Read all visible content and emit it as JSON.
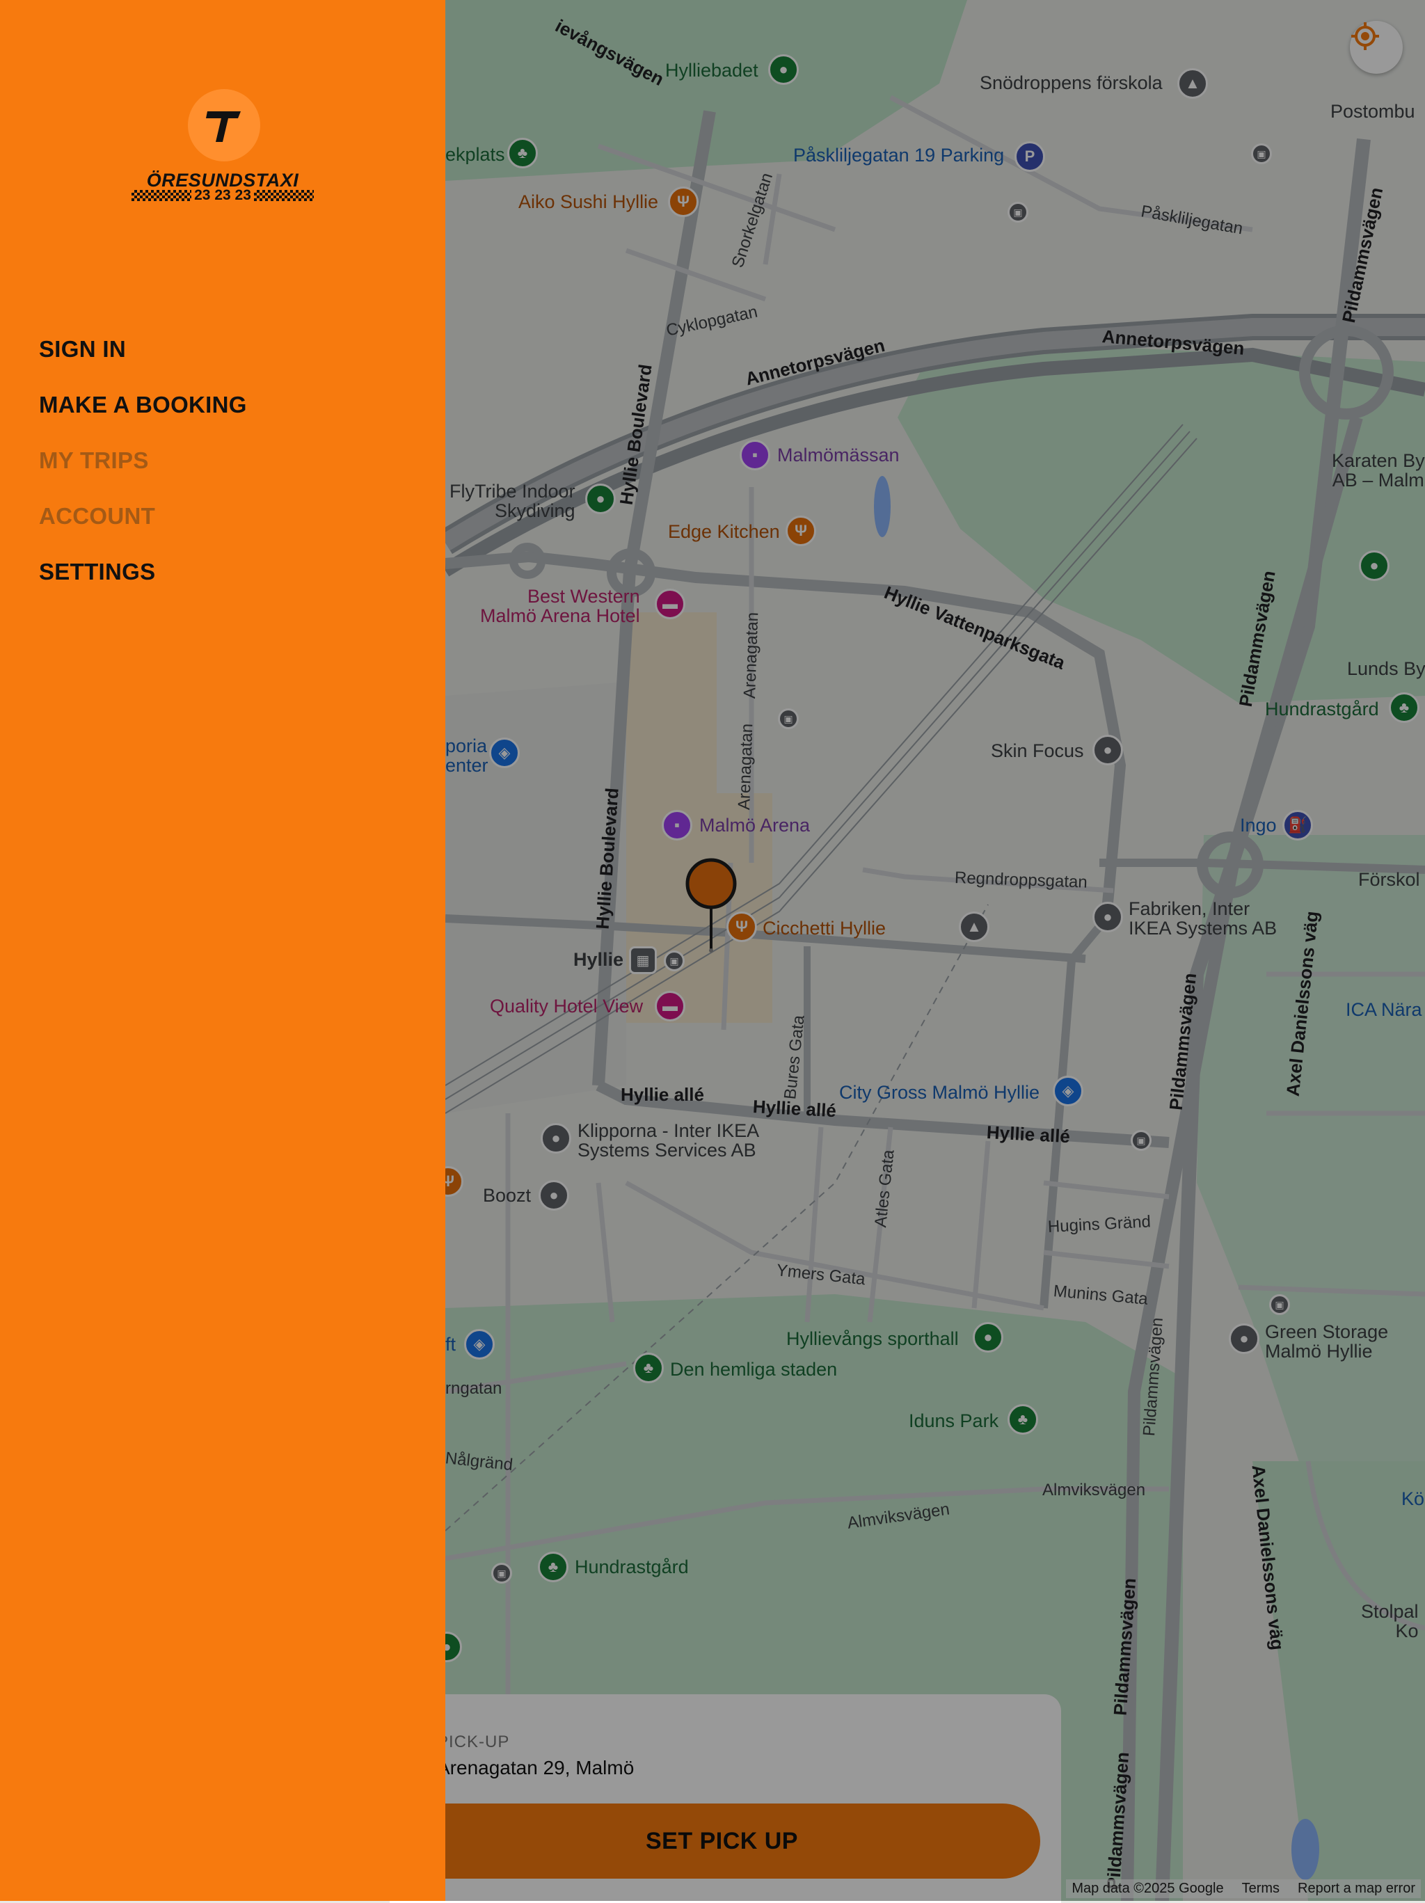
{
  "drawer": {
    "logo": {
      "name": "ÖRESUNDSTAXI",
      "phone": "23 23 23",
      "initial": "T"
    },
    "menu": [
      {
        "label": "SIGN IN",
        "enabled": true
      },
      {
        "label": "MAKE A BOOKING",
        "enabled": true
      },
      {
        "label": "MY TRIPS",
        "enabled": false
      },
      {
        "label": "ACCOUNT",
        "enabled": false
      },
      {
        "label": "SETTINGS",
        "enabled": true
      }
    ],
    "color": "#f77a0e"
  },
  "map": {
    "poi": {
      "hylliebadet": "Hylliebadet",
      "snodroppens": "Snödroppens förskola",
      "postombud": "Postombu",
      "ekplats": "ekplats",
      "paskliljegatan_parking": "Påskliljegatan 19 Parking",
      "aiko_sushi": "Aiko Sushi Hyllie",
      "malmomassan": "Malmömässan",
      "karaten": "Karaten By\nAB – Malm",
      "flytribe": "FlyTribe Indoor\nSkydiving",
      "edge_kitchen": "Edge Kitchen",
      "best_western": "Best Western\nMalmö Arena Hotel",
      "lunds": "Lunds By",
      "hundrastgard1": "Hundrastgård",
      "emporia": "poria\nenter",
      "skin_focus": "Skin Focus",
      "malmo_arena": "Malmö Arena",
      "ingo": "Ingo",
      "forskola": "Förskol",
      "fabriken": "Fabriken, Inter\nIKEA Systems AB",
      "cicchetti": "Cicchetti Hyllie",
      "hyllie": "Hyllie",
      "quality_hotel": "Quality Hotel View",
      "ica": "ICA Nära",
      "city_gross": "City Gross Malmö Hyllie",
      "klipporna": "Klipporna - Inter IKEA\nSystems Services AB",
      "boozt": "Boozt",
      "ft": "ft",
      "hyllievangs": "Hyllievångs sporthall",
      "green_storage": "Green Storage\nMalmö Hyllie",
      "den_hemliga": "Den hemliga staden",
      "iduns_park": "Iduns Park",
      "ko": "Kö",
      "hundrastgard2": "Hundrastgård",
      "stolpal": "Stolpal\nKo"
    },
    "streets": {
      "hyllievangsvagen": "ievångsvägen",
      "snorkelgatan": "Snorkelgatan",
      "paskliljegatan": "Påskliljegatan",
      "pildammsvagen": "Pildammsvägen",
      "cyklopgatan": "Cyklopgatan",
      "annetorpsvagen": "Annetorpsvägen",
      "hyllie_boulevard": "Hyllie Boulevard",
      "hyllie_vattenparksgata": "Hyllie Vattenparksgata",
      "arenagatan": "Arenagatan",
      "regndroppsgatan": "Regndroppsgatan",
      "axel_danielssons_vag": "Axel Danielssons väg",
      "hyllie_alle": "Hyllie allé",
      "bures_gata": "Bures Gata",
      "atles_gata": "Atles Gata",
      "hugins_grand": "Hugins Gränd",
      "ymers_gata": "Ymers Gata",
      "munins_gata": "Munins Gata",
      "rngatan": "rngatan",
      "nalgrand": "Nålgränd",
      "almviksvagen": "Almviksvägen"
    },
    "attribution": {
      "data": "Map data ©2025 Google",
      "terms": "Terms",
      "report": "Report a map error"
    }
  },
  "pickup": {
    "label": "PICK-UP",
    "address": "Arenagatan 29, Malmö",
    "button": "SET PICK UP"
  },
  "icons": {
    "locate": "my-location-icon",
    "pin": "map-pin-icon",
    "logo": "taxi-logo-icon"
  }
}
